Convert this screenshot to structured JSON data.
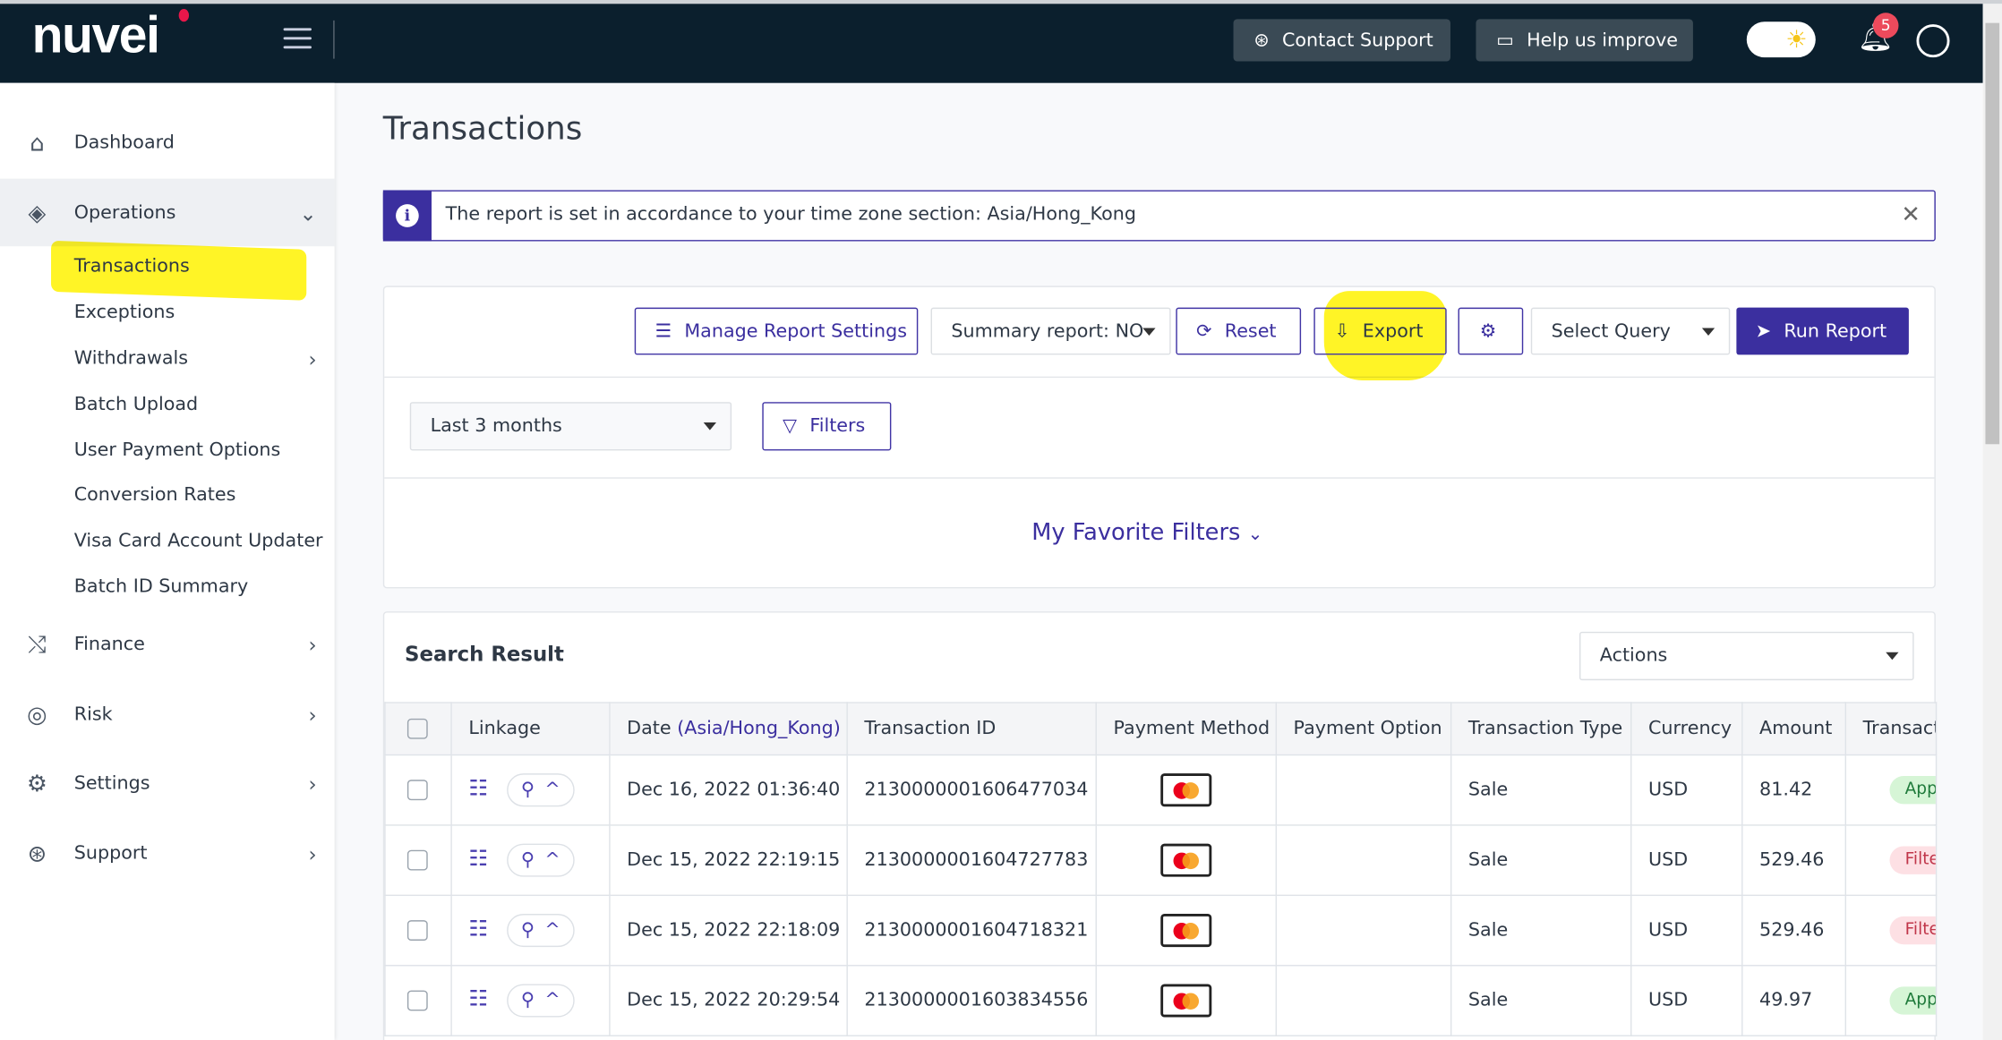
{
  "header": {
    "logo": "nuvei",
    "contact_support": "Contact Support",
    "help_improve": "Help us improve",
    "notifications_count": "5"
  },
  "sidebar": {
    "items": [
      {
        "label": "Dashboard",
        "icon": "home-icon"
      },
      {
        "label": "Operations",
        "icon": "layers-icon",
        "expanded": true,
        "children": [
          "Transactions",
          "Exceptions",
          "Withdrawals",
          "Batch Upload",
          "User Payment Options",
          "Conversion Rates",
          "Visa Card Account Updater",
          "Batch ID Summary"
        ]
      },
      {
        "label": "Finance",
        "icon": "finance-icon"
      },
      {
        "label": "Risk",
        "icon": "fingerprint-icon"
      },
      {
        "label": "Settings",
        "icon": "gear-icon"
      },
      {
        "label": "Support",
        "icon": "lifebuoy-icon"
      }
    ],
    "active": "Transactions"
  },
  "page": {
    "title": "Transactions",
    "banner": "The report is set in accordance to your time zone section: Asia/Hong_Kong"
  },
  "toolbar": {
    "manage": "Manage Report Settings",
    "summary": "Summary report: NO",
    "reset": "Reset",
    "export": "Export",
    "select_query": "Select Query",
    "run": "Run Report"
  },
  "filters": {
    "period": "Last 3 months",
    "filters": "Filters",
    "favorites": "My Favorite Filters"
  },
  "results": {
    "title": "Search Result",
    "actions": "Actions",
    "columns": [
      "Linkage",
      "Date",
      "(Asia/Hong_Kong)",
      "Transaction ID",
      "Payment Method",
      "Payment Option",
      "Transaction Type",
      "Currency",
      "Amount",
      "Transact"
    ],
    "rows": [
      {
        "date": "Dec 16, 2022 01:36:40",
        "id": "2130000001606477034",
        "type": "Sale",
        "currency": "USD",
        "amount": "81.42",
        "status": "App"
      },
      {
        "date": "Dec 15, 2022 22:19:15",
        "id": "2130000001604727783",
        "type": "Sale",
        "currency": "USD",
        "amount": "529.46",
        "status": "Filte"
      },
      {
        "date": "Dec 15, 2022 22:18:09",
        "id": "2130000001604718321",
        "type": "Sale",
        "currency": "USD",
        "amount": "529.46",
        "status": "Filte"
      },
      {
        "date": "Dec 15, 2022 20:29:54",
        "id": "2130000001603834556",
        "type": "Sale",
        "currency": "USD",
        "amount": "49.97",
        "status": "App"
      }
    ]
  },
  "colors": {
    "header": "#0b1f2d",
    "accent": "#3b2f9f",
    "highlight": "#fff200",
    "approved": "#d6f5d6",
    "filtered": "#fde0e4"
  }
}
